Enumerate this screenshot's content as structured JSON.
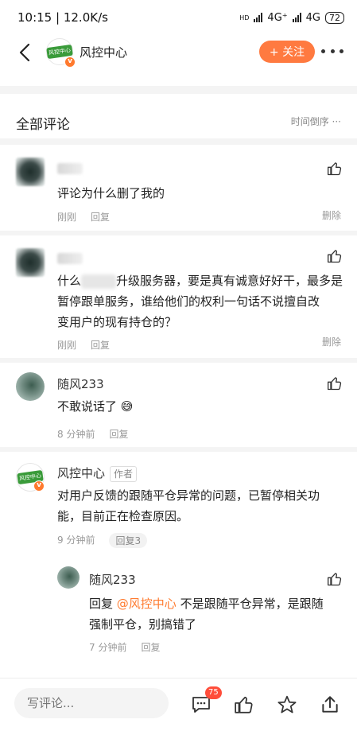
{
  "status": {
    "time": "10:15",
    "speed": "12.0K/s",
    "hd": "HD",
    "net1": "4G⁺",
    "net2": "4G",
    "battery": "72"
  },
  "header": {
    "title": "风控中心",
    "follow_label": "+ 关注",
    "logo_text": "风控中心"
  },
  "comments_header": {
    "title": "全部评论",
    "sort_label": "时间倒序"
  },
  "comments": [
    {
      "text": "评论为什么删了我的",
      "time": "刚刚",
      "reply": "回复",
      "delete": "删除"
    },
    {
      "text_start": "什么",
      "text_rest": "升级服务器，要是真有诚意好好干，最多是",
      "line2": "暂停跟单服务，谁给他们的权利一句话不说擅自改",
      "line3": "变用户的现有持仓的？",
      "time": "刚刚",
      "reply": "回复",
      "delete": "删除"
    },
    {
      "name": "随风233",
      "text": "不敢说话了",
      "emoji": "😅",
      "time": "8 分钟前",
      "reply": "回复"
    },
    {
      "name": "风控中心",
      "author_tag": "作者",
      "line1": "对用户反馈的跟随平仓异常的问题，已暂停相关功",
      "line2": "能，目前正在检查原因。",
      "time": "9 分钟前",
      "reply": "回复3"
    }
  ],
  "sub_reply": {
    "name": "随风233",
    "prefix": "回复 ",
    "mention": "@风控中心",
    "line1_rest": " 不是跟随平仓异常，是跟随",
    "line2": "强制平仓，别搞错了",
    "time": "7 分钟前",
    "reply": "回复"
  },
  "bottom": {
    "placeholder": "写评论...",
    "comment_count": "75"
  },
  "colors": {
    "accent": "#ff7a40",
    "badge": "#ff4d3a",
    "brand_green": "#3a9b3a"
  }
}
